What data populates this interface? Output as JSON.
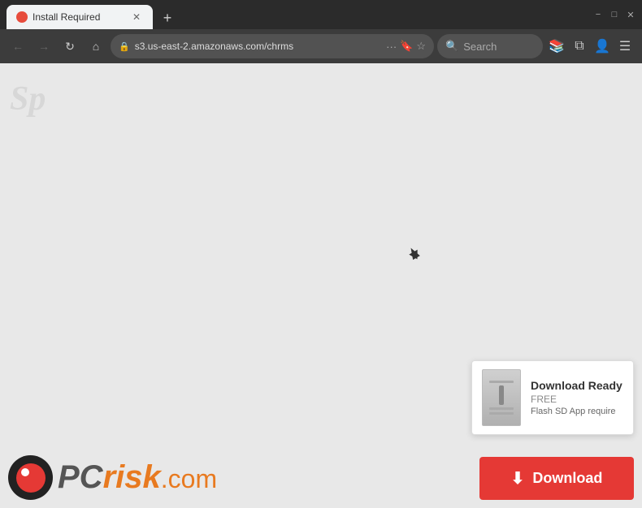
{
  "titlebar": {
    "tab": {
      "title": "Install Required",
      "favicon": "bug-icon"
    },
    "new_tab_label": "+",
    "controls": {
      "minimize": "−",
      "maximize": "□",
      "close": "✕"
    }
  },
  "navbar": {
    "back_label": "←",
    "forward_label": "→",
    "refresh_label": "↻",
    "home_label": "⌂",
    "address": "s3.us-east-2.amazonaws.com/chrms",
    "more_label": "···",
    "search_placeholder": "Search"
  },
  "page": {
    "watermark": "Sp",
    "download_card": {
      "ready_label": "Download Ready",
      "free_label": "FREE",
      "desc_label": "Flash SD App require"
    },
    "download_button_label": "Download"
  },
  "logo": {
    "pc_text": "PC",
    "risk_text": "risk",
    "dot_com_text": ".com"
  }
}
